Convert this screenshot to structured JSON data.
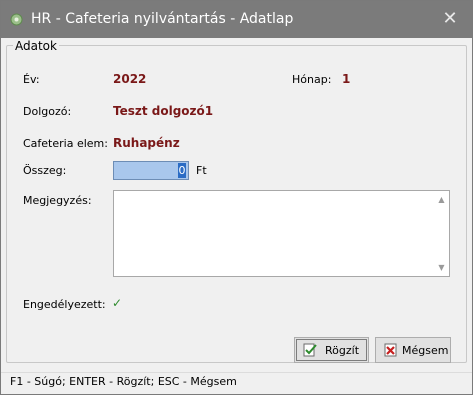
{
  "window": {
    "title": "HR - Cafeteria nyilvántartás - Adatlap",
    "close_symbol": "✕"
  },
  "group": {
    "title": "Adatok"
  },
  "fields": {
    "year_label": "Év:",
    "year_value": "2022",
    "month_label": "Hónap:",
    "month_value": "1",
    "employee_label": "Dolgozó:",
    "employee_value": "Teszt dolgozó1",
    "item_label": "Cafeteria elem:",
    "item_value": "Ruhapénz",
    "amount_label": "Összeg:",
    "amount_value": "0",
    "amount_unit": "Ft",
    "notes_label": "Megjegyzés:",
    "notes_value": "",
    "approved_label": "Engedélyezett:",
    "approved_checked": true
  },
  "buttons": {
    "save_label": "Rögzít",
    "cancel_label": "Mégsem"
  },
  "statusbar": {
    "text": "F1 - Súgó; ENTER - Rögzít; ESC - Mégsem"
  },
  "colors": {
    "titlebar": "#7b7b7b",
    "value_text": "#7a1818",
    "check": "#2e8b2e",
    "selection": "#a9c7ec"
  },
  "icons": {
    "app": "app-icon",
    "close": "close-icon",
    "save": "save-check-icon",
    "cancel": "cancel-x-icon"
  }
}
